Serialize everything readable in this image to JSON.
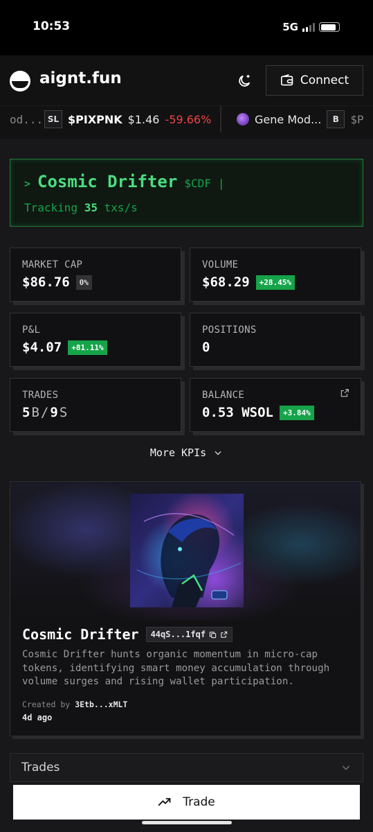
{
  "status_bar": {
    "time": "10:53",
    "network": "5G",
    "signal_level": 0.5,
    "battery_level": 0.85
  },
  "header": {
    "brand": "aignt.fun",
    "connect_label": "Connect",
    "icons": [
      "logo-icon",
      "theme-toggle-icon",
      "wallet-icon"
    ]
  },
  "ticker": [
    {
      "name": "od..."
    },
    {
      "badge": "SL",
      "symbol": "$PIXPNK",
      "price": "$1.46",
      "change": "-59.66%",
      "change_color": "#ef4444"
    },
    {
      "name": "Gene Mod...",
      "badge": "B",
      "symbol": "$P"
    }
  ],
  "agent": {
    "caret": ">",
    "name": "Cosmic Drifter",
    "ticker": "$CDF",
    "cursor": "|",
    "tracking_prefix": "Tracking",
    "tracking_value": "35",
    "tracking_suffix": "txs/s"
  },
  "kpis": {
    "market_cap": {
      "label": "MARKET CAP",
      "value": "$86.76",
      "chip": "0%"
    },
    "volume": {
      "label": "VOLUME",
      "value": "$68.29",
      "chip": "+28.45%"
    },
    "pnl": {
      "label": "P&L",
      "value": "$4.07",
      "chip": "+81.11%"
    },
    "positions": {
      "label": "POSITIONS",
      "value": "0"
    },
    "trades": {
      "label": "TRADES",
      "buys": "5",
      "buy_unit": "B",
      "sep": "/",
      "sells": "9",
      "sell_unit": "S"
    },
    "balance": {
      "label": "BALANCE",
      "value": "0.53 WSOL",
      "chip": "+3.84%"
    }
  },
  "more_kpis_label": "More KPIs",
  "card": {
    "name": "Cosmic Drifter",
    "address": "44qS...1fqf",
    "description": "Cosmic Drifter hunts organic momentum in micro-cap tokens, identifying smart money accumulation through volume surges and rising wallet participation.",
    "created_prefix": "Created by",
    "creator": "3Etb...xMLT",
    "age": "4d ago"
  },
  "trades_section": {
    "label": "Trades"
  },
  "trade_button": {
    "label": "Trade"
  },
  "colors": {
    "accent_green": "#4ade80",
    "chip_green": "#16a34a",
    "negative": "#ef4444"
  }
}
